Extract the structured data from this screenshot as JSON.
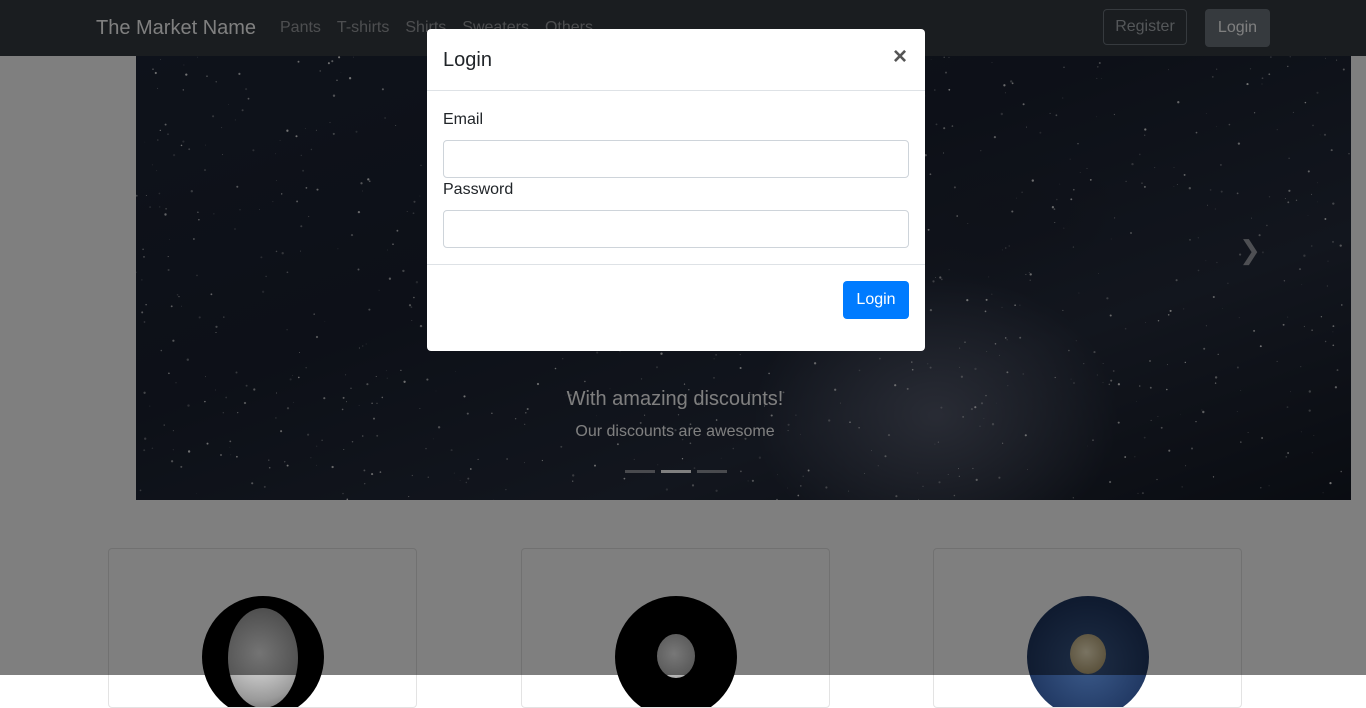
{
  "navbar": {
    "brand": "The Market Name",
    "links": [
      "Pants",
      "T-shirts",
      "Shirts",
      "Sweaters",
      "Others"
    ],
    "register_label": "Register",
    "login_label": "Login"
  },
  "carousel": {
    "caption_title": "With amazing discounts!",
    "caption_subtitle": "Our discounts are awesome",
    "slide_count": 3,
    "active_slide": 2
  },
  "login_modal": {
    "title": "Login",
    "close_symbol": "×",
    "email_label": "Email",
    "email_value": "",
    "password_label": "Password",
    "password_value": "",
    "submit_label": "Login"
  },
  "colors": {
    "navbar": "#343a40",
    "primary": "#007bff",
    "secondary": "#6c757d"
  }
}
